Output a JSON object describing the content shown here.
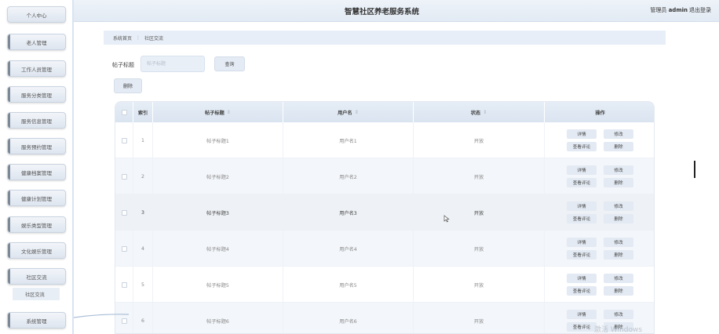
{
  "header": {
    "title": "智慧社区养老服务系统",
    "user_prefix": "管理员",
    "username": "admin",
    "logout_label": "退出登录"
  },
  "sidebar": {
    "items": [
      {
        "label": "个人中心"
      },
      {
        "label": "老人管理"
      },
      {
        "label": "工作人员管理"
      },
      {
        "label": "服务分类管理"
      },
      {
        "label": "服务信息管理"
      },
      {
        "label": "服务预约管理"
      },
      {
        "label": "健康档案管理"
      },
      {
        "label": "健康计划管理"
      },
      {
        "label": "娱乐类型管理"
      },
      {
        "label": "文化娱乐管理"
      },
      {
        "label": "社区交流"
      },
      {
        "label": "系统管理"
      }
    ],
    "sub_item": "社区交流"
  },
  "breadcrumb": {
    "home": "系统首页",
    "separator": "⋮",
    "current": "社区交流"
  },
  "search": {
    "label": "帖子标题",
    "placeholder": "帖子标题",
    "query_label": "查询"
  },
  "actions": {
    "delete_label": "删除"
  },
  "table": {
    "headers": {
      "index": "索引",
      "title": "帖子标题",
      "username": "用户名",
      "status": "状态",
      "ops": "操作"
    },
    "sort_icon": "⇕",
    "rows": [
      {
        "index": "1",
        "title": "帖子标题1",
        "username": "用户名1",
        "status": "开放"
      },
      {
        "index": "2",
        "title": "帖子标题2",
        "username": "用户名2",
        "status": "开放"
      },
      {
        "index": "3",
        "title": "帖子标题3",
        "username": "用户名3",
        "status": "开放"
      },
      {
        "index": "4",
        "title": "帖子标题4",
        "username": "用户名4",
        "status": "开放"
      },
      {
        "index": "5",
        "title": "帖子标题5",
        "username": "用户名5",
        "status": "开放"
      },
      {
        "index": "6",
        "title": "帖子标题6",
        "username": "用户名6",
        "status": "开放"
      }
    ],
    "row_buttons": {
      "detail": "详情",
      "edit": "修改",
      "comments": "查看评论",
      "delete": "删除"
    }
  },
  "watermark": "激活 Windows",
  "colors": {
    "accent": "#e4ebf4",
    "header_bg": "#e8eff7",
    "alt_row": "#f3f6fa"
  }
}
